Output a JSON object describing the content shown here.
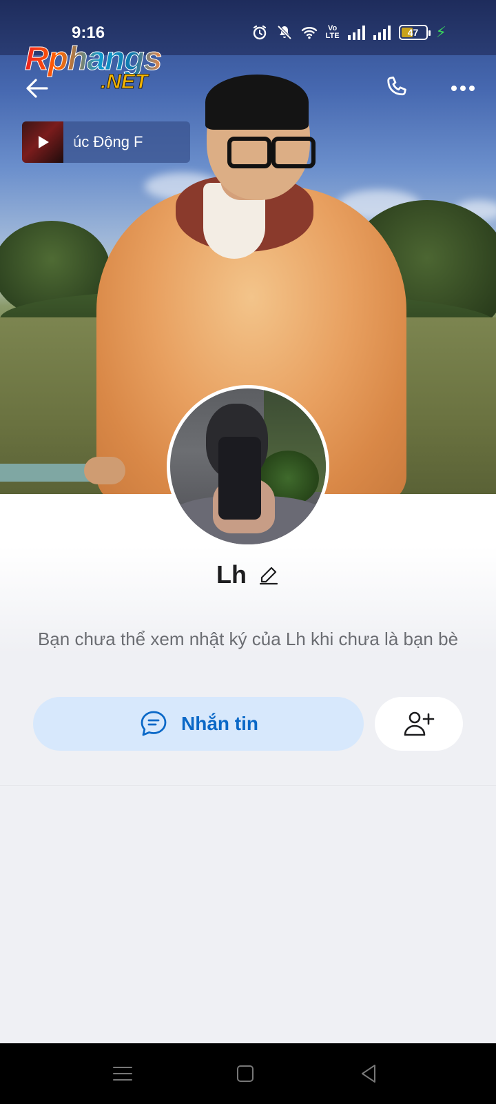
{
  "status_bar": {
    "time": "9:16",
    "network_label_top": "Vo",
    "network_label_bottom": "LTE",
    "battery_level": "47",
    "charging": true,
    "icons": [
      "alarm-icon",
      "silent-icon",
      "wifi-icon",
      "volte-icon",
      "signal-icon",
      "signal-icon",
      "battery-icon",
      "charging-icon"
    ]
  },
  "watermark": {
    "line1": "Rphangs",
    "line2": ".NET"
  },
  "top_nav": {
    "icons": [
      "back-arrow-icon",
      "phone-icon",
      "more-icon"
    ]
  },
  "music": {
    "scrolling_text": "úc      Động F"
  },
  "profile": {
    "name": "Lh",
    "notice": "Bạn chưa thể xem nhật ký của Lh khi chưa là bạn bè"
  },
  "actions": {
    "message_label": "Nhắn tin",
    "message_icon": "chat-bubble-icon",
    "add_friend_icon": "add-friend-icon"
  },
  "colors": {
    "accent": "#0a68c7",
    "message_button_bg": "#d7e8fc",
    "page_bg": "#eff0f4",
    "battery_fill": "#c8a21b",
    "charging": "#3ad65c"
  },
  "navigation_bar": {
    "icons": [
      "menu-icon",
      "home-icon",
      "back-icon"
    ]
  }
}
